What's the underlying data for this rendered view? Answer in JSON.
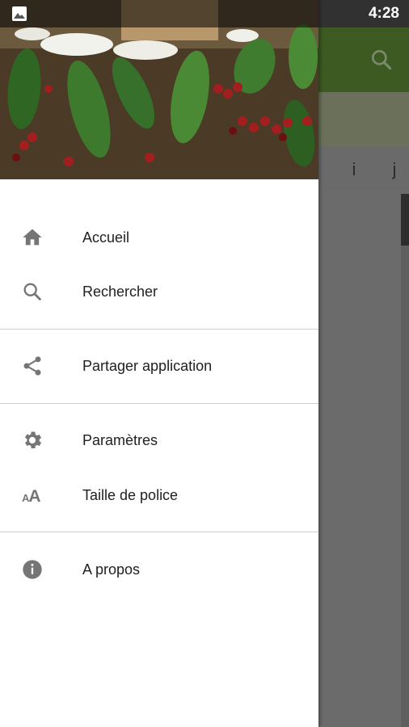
{
  "status_bar": {
    "time": "4:28",
    "notification_icon": "image-icon"
  },
  "background_app": {
    "toolbar_icon": "search-icon",
    "tabs": [
      "i",
      "j"
    ],
    "toolbar_color": "#3d5a22"
  },
  "drawer": {
    "header_image": "coffee-plant-photo",
    "groups": [
      {
        "items": [
          {
            "label": "Accueil",
            "icon": "home-icon"
          },
          {
            "label": "Rechercher",
            "icon": "search-icon"
          }
        ]
      },
      {
        "items": [
          {
            "label": "Partager application",
            "icon": "share-icon"
          }
        ]
      },
      {
        "items": [
          {
            "label": "Paramètres",
            "icon": "gear-icon"
          },
          {
            "label": "Taille de police",
            "icon": "font-size-icon"
          }
        ]
      },
      {
        "items": [
          {
            "label": "A propos",
            "icon": "info-icon"
          }
        ]
      }
    ]
  }
}
